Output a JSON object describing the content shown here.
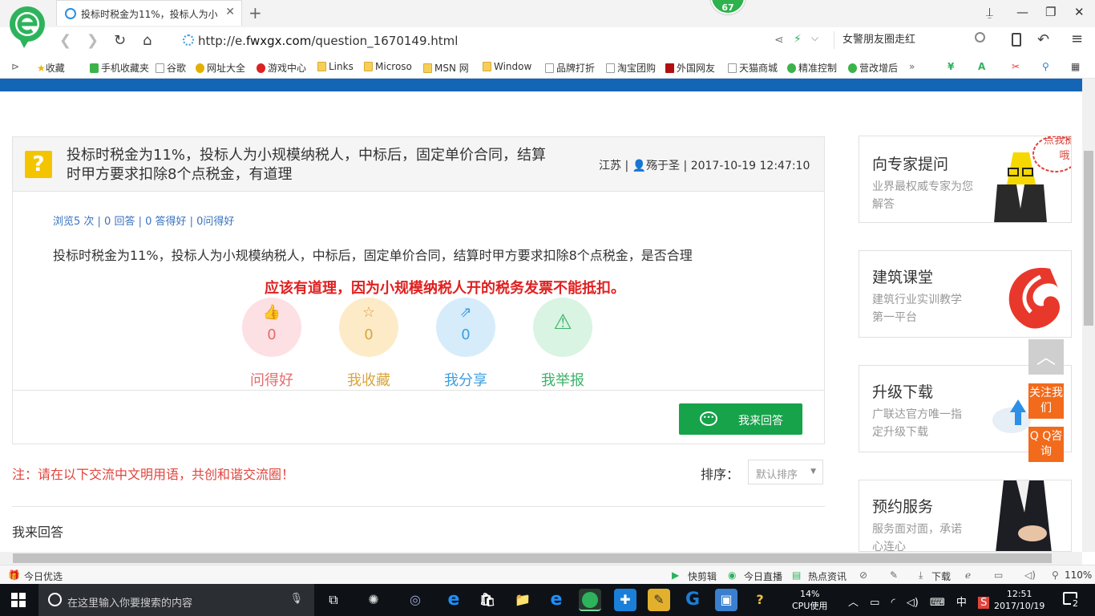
{
  "browser": {
    "tab_title": "投标时税金为11%，投标人为小规",
    "hot_badge": "67",
    "url_prefix": "http://e.",
    "url_host": "fwxgx.com",
    "url_path": "/question_1670149.html",
    "search_text": "女警朋友圈走红",
    "bookmarks": [
      "收藏",
      "手机收藏夹",
      "谷歌",
      "网址大全",
      "游戏中心",
      "Links",
      "Microso",
      "MSN 网",
      "Window",
      "品牌打折",
      "淘宝团购",
      "外国网友",
      "天猫商城",
      "精准控制",
      "营改增后"
    ]
  },
  "question": {
    "title": "投标时税金为11%，投标人为小规模纳税人，中标后，固定单价合同，结算时甲方要求扣除8个点税金，有道理",
    "region": "江苏",
    "author": "殇于圣",
    "datetime": "2017-10-19 12:47:10",
    "stats": "浏览5 次 | 0 回答 | 0 答得好 | 0问得好",
    "body": "投标时税金为11%，投标人为小规模纳税人，中标后，固定单价合同，结算时甲方要求扣除8个点税金，是否合理",
    "answer_highlight": "应该有道理，因为小规模纳税人开的税务发票不能抵扣。"
  },
  "actions": [
    {
      "label": "问得好",
      "count": "0",
      "color": "#e86a6a",
      "bg": "#fde0e3",
      "icon": "thumbs-up-icon"
    },
    {
      "label": "我收藏",
      "count": "0",
      "color": "#d9a53c",
      "bg": "#fdebc8",
      "icon": "star-icon"
    },
    {
      "label": "我分享",
      "count": "0",
      "color": "#3b9ee0",
      "bg": "#d6ecfb",
      "icon": "share-icon"
    },
    {
      "label": "我举报",
      "count": "",
      "color": "#3bb26a",
      "bg": "#d9f4e2",
      "icon": "warning-icon"
    }
  ],
  "reply_button": "我来回答",
  "note": "注：请在以下交流中文明用语，共创和谐交流圈！",
  "sort": {
    "label": "排序：",
    "value": "默认排序"
  },
  "my_reply": "我来回答",
  "sidebar": {
    "ask": {
      "title": "向专家提问",
      "sub": "业界最权威专家为您解答",
      "bubble": "点我提问哦"
    },
    "course": {
      "title": "建筑课堂",
      "sub": "建筑行业实训教学第一平台"
    },
    "upgrade": {
      "title": "升级下载",
      "sub": "广联达官方唯一指定升级下载"
    },
    "service": {
      "title": "预约服务",
      "sub": "服务面对面，承诺心连心"
    },
    "follow": "关注我们",
    "qq": "Q Q咨询"
  },
  "statusbar": {
    "today": "今日优选",
    "kuaijian": "快剪辑",
    "live": "今日直播",
    "news": "热点资讯",
    "download": "下载",
    "zoom": "110%"
  },
  "taskbar": {
    "search_placeholder": "在这里输入你要搜索的内容",
    "cpu_percent": "14%",
    "cpu_label": "CPU使用",
    "ime": "中",
    "time": "12:51",
    "date": "2017/10/19",
    "notifications": "2"
  }
}
